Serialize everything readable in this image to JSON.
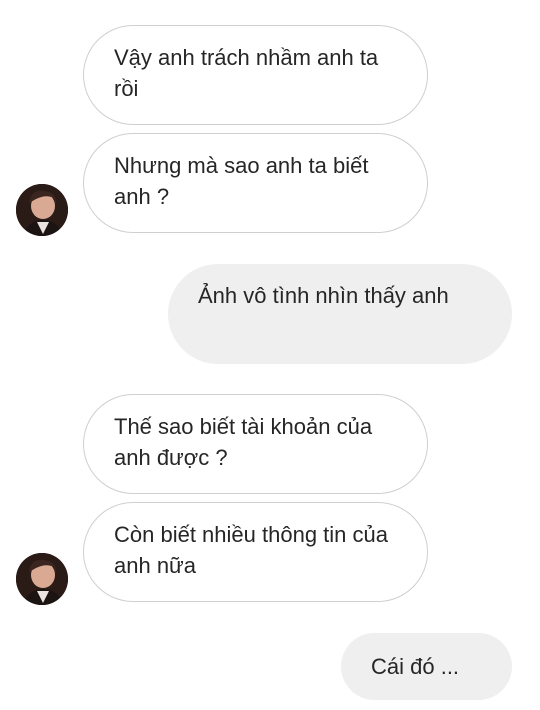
{
  "messages": [
    {
      "side": "incoming",
      "text": "Vậy anh trách nhầm anh ta rồi"
    },
    {
      "side": "incoming",
      "text": "Nhưng mà sao anh ta biết anh ?"
    },
    {
      "side": "outgoing",
      "text": "Ảnh vô tình nhìn thấy anh"
    },
    {
      "side": "incoming",
      "text": "Thế sao biết tài khoản của anh được ?"
    },
    {
      "side": "incoming",
      "text": "Còn biết nhiều thông tin của anh nữa"
    },
    {
      "side": "outgoing",
      "text": "Cái đó ..."
    }
  ],
  "colors": {
    "incoming_bg": "#ffffff",
    "incoming_border": "#cfcfcf",
    "outgoing_bg": "#efefef",
    "text": "#262626"
  }
}
